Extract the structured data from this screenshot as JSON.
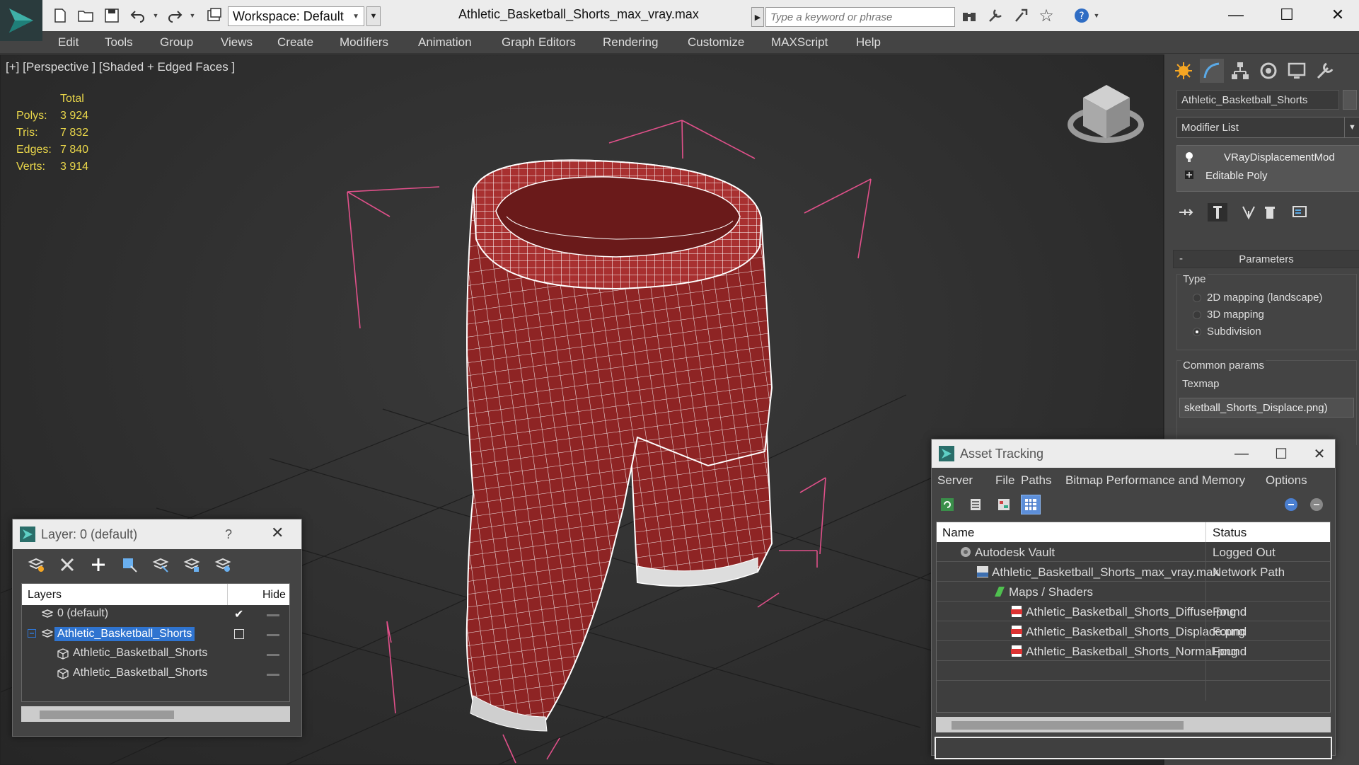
{
  "titlebar": {
    "workspace": "Workspace: Default",
    "title": "Athletic_Basketball_Shorts_max_vray.max",
    "search_placeholder": "Type a keyword or phrase"
  },
  "menubar": [
    "Edit",
    "Tools",
    "Group",
    "Views",
    "Create",
    "Modifiers",
    "Animation",
    "Graph Editors",
    "Rendering",
    "Customize",
    "MAXScript",
    "Help"
  ],
  "viewport": {
    "label": "[+] [Perspective ] [Shaded + Edged Faces ]",
    "stats_header": "Total",
    "stats": [
      {
        "k": "Polys:",
        "v": "3 924"
      },
      {
        "k": "Tris:",
        "v": "7 832"
      },
      {
        "k": "Edges:",
        "v": "7 840"
      },
      {
        "k": "Verts:",
        "v": "3 914"
      }
    ],
    "mesh_color": "#8e2424",
    "bbox_color": "#e0508a"
  },
  "command_panel": {
    "object_name": "Athletic_Basketball_Shorts",
    "modifier_list": "Modifier List",
    "stack": [
      "VRayDisplacementMod",
      "Editable Poly"
    ],
    "params_title": "Parameters",
    "params_minus": "-",
    "type_label": "Type",
    "type_options": [
      {
        "label": "2D mapping (landscape)",
        "selected": false
      },
      {
        "label": "3D mapping",
        "selected": false
      },
      {
        "label": "Subdivision",
        "selected": true
      }
    ],
    "common_label": "Common params",
    "texmap_label": "Texmap",
    "texmap_value": "sketball_Shorts_Displace.png)"
  },
  "asset_tracking": {
    "title": "Asset Tracking",
    "menu": [
      "Server",
      "File",
      "Paths",
      "Bitmap Performance and Memory",
      "Options"
    ],
    "col_name": "Name",
    "col_status": "Status",
    "rows": [
      {
        "name": "Autodesk Vault",
        "status": "Logged Out",
        "indent": 1,
        "icon": "vault-icon"
      },
      {
        "name": "Athletic_Basketball_Shorts_max_vray.max",
        "status": "Network Path",
        "indent": 2,
        "icon": "max-file-icon"
      },
      {
        "name": "Maps / Shaders",
        "status": "",
        "indent": 3,
        "icon": "maps-icon"
      },
      {
        "name": "Athletic_Basketball_Shorts_Diffuse.png",
        "status": "Found",
        "indent": 4,
        "icon": "png-icon"
      },
      {
        "name": "Athletic_Basketball_Shorts_Displace.png",
        "status": "Found",
        "indent": 4,
        "icon": "png-icon"
      },
      {
        "name": "Athletic_Basketball_Shorts_Normal.png",
        "status": "Found",
        "indent": 4,
        "icon": "png-icon"
      }
    ]
  },
  "layer_window": {
    "title": "Layer: 0 (default)",
    "help": "?",
    "col_layers": "Layers",
    "col_hide": "Hide",
    "rows": [
      {
        "name": "0 (default)",
        "indent": 1,
        "icon": "layer-icon",
        "selected": false
      },
      {
        "name": "Athletic_Basketball_Shorts",
        "indent": 1,
        "icon": "layer-icon",
        "selected": true
      },
      {
        "name": "Athletic_Basketball_Shorts",
        "indent": 2,
        "icon": "object-icon",
        "selected": false
      },
      {
        "name": "Athletic_Basketball_Shorts",
        "indent": 2,
        "icon": "object-icon",
        "selected": false
      }
    ]
  }
}
